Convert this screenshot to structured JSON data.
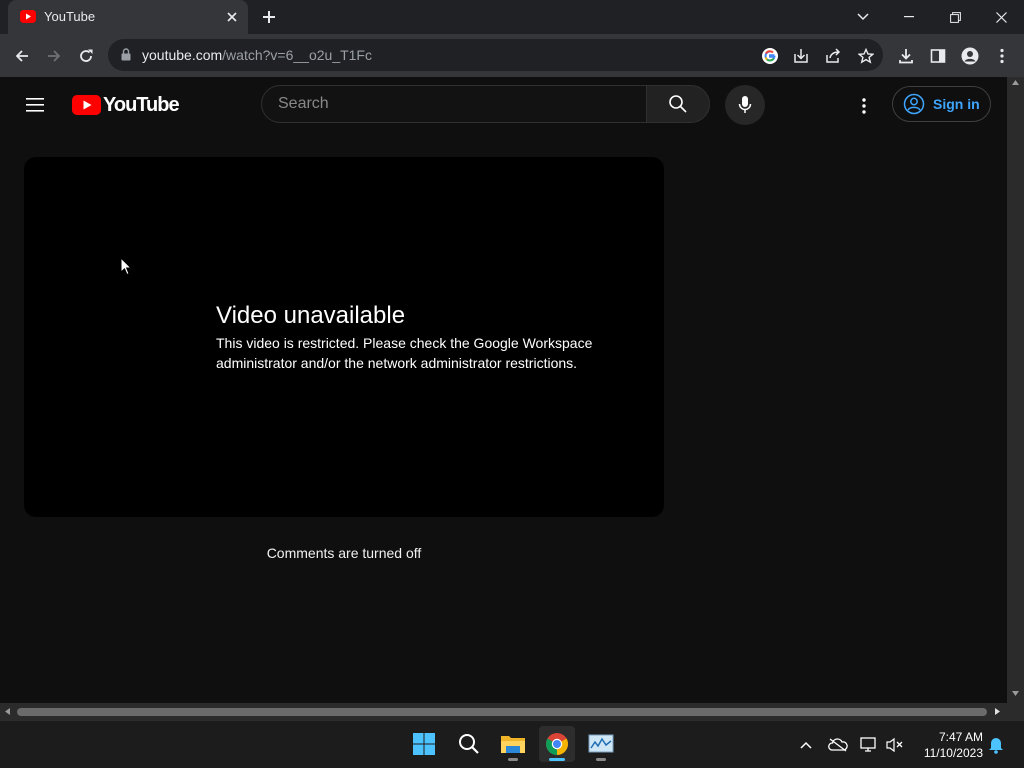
{
  "browser": {
    "tab": {
      "title": "YouTube"
    },
    "url": {
      "host": "youtube.com",
      "path": "/watch?v=6__o2u_T1Fc"
    }
  },
  "masthead": {
    "logo_text": "YouTube",
    "search_placeholder": "Search",
    "sign_in_label": "Sign in"
  },
  "player": {
    "error_title": "Video unavailable",
    "error_message": "This video is restricted. Please check the Google Workspace administrator and/or the network administrator restrictions."
  },
  "comments_notice": "Comments are turned off",
  "taskbar": {
    "time": "7:47 AM",
    "date": "11/10/2023"
  },
  "colors": {
    "youtube_red": "#ff0000",
    "link_blue": "#3ea6ff",
    "page_bg": "#0f0f0f"
  }
}
